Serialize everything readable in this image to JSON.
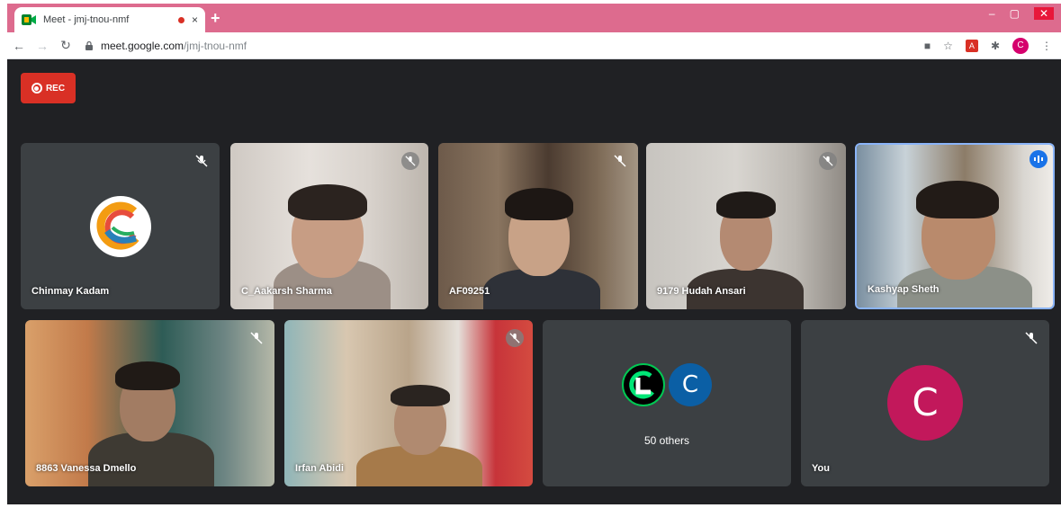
{
  "browser": {
    "tab_title": "Meet - jmj-tnou-nmf",
    "tab_close": "×",
    "new_tab": "+",
    "url_host": "meet.google.com",
    "url_path": "/jmj-tnou-nmf",
    "profile_initial": "C",
    "window_controls": [
      "–",
      "▢",
      "✕"
    ]
  },
  "meet": {
    "rec_label": "REC",
    "accent_color": "#1a73e8",
    "rec_color": "#d93025",
    "others_count_label": "50 others",
    "others_avatar_initial": "C",
    "self_initial": "C",
    "tiles_row1": [
      {
        "name": "Chinmay Kadam",
        "type": "logo",
        "muted": true
      },
      {
        "name": "C_Aakarsh Sharma",
        "type": "video",
        "muted": true
      },
      {
        "name": "AF09251",
        "type": "video",
        "muted": true
      },
      {
        "name": "9179 Hudah Ansari",
        "type": "video",
        "muted": true
      },
      {
        "name": "Kashyap Sheth",
        "type": "video",
        "speaking": true
      }
    ],
    "tiles_row2": [
      {
        "name": "8863 Vanessa Dmello",
        "type": "video",
        "muted": true
      },
      {
        "name": "Irfan Abidi",
        "type": "video",
        "muted": true
      },
      {
        "name": "",
        "type": "others"
      },
      {
        "name": "You",
        "type": "self",
        "muted": true
      }
    ]
  }
}
